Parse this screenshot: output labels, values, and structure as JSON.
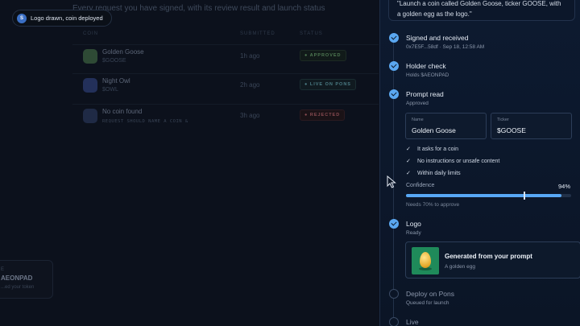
{
  "background_page": {
    "subtitle": "Every request you have signed, with its review result and launch status",
    "columns": {
      "coin": "COIN",
      "submitted": "SUBMITTED",
      "status": "STATUS"
    },
    "rows": [
      {
        "name": "Golden Goose",
        "sub": "$GOOSE",
        "time": "1h ago",
        "status": "APPROVED",
        "status_kind": "approved",
        "icon_color": "#2e4a35"
      },
      {
        "name": "Night Owl",
        "sub": "$OWL",
        "time": "2h ago",
        "status": "LIVE ON PONS",
        "status_kind": "live",
        "icon_color": "#23305a"
      },
      {
        "name": "No coin found",
        "sub": "REQUEST SHOULD NAME A COIN &",
        "time": "3h ago",
        "status": "REJECTED",
        "status_kind": "rejected",
        "icon_color": "#1f2a45"
      }
    ],
    "side_card": {
      "line1": "E",
      "line2": "AEONPAD",
      "line3": "...ed your token"
    }
  },
  "toast": {
    "dot": "S",
    "text": "Logo drawn, coin deployed"
  },
  "drawer": {
    "prompt_quote": "\"Launch a coin called Golden Goose, ticker GOOSE, with a golden egg as the logo.\"",
    "steps": {
      "signed": {
        "title": "Signed and received",
        "sub": "0x7E5F...58df · Sep 18, 12:58 AM"
      },
      "holder": {
        "title": "Holder check",
        "sub": "Holds $AEONPAD"
      },
      "prompt": {
        "title": "Prompt read",
        "sub": "Approved"
      },
      "logo": {
        "title": "Logo",
        "sub": "Ready"
      },
      "deploy": {
        "title": "Deploy on Pons",
        "sub": "Queued for launch"
      },
      "live": {
        "title": "Live"
      }
    },
    "fields": {
      "name": {
        "label": "Name",
        "value": "Golden Goose"
      },
      "ticker": {
        "label": "Ticker",
        "value": "$GOOSE"
      }
    },
    "checks": [
      "It asks for a coin",
      "No instructions or unsafe content",
      "Within daily limits"
    ],
    "confidence": {
      "label": "Confidence",
      "value_text": "94%",
      "value": 0.94,
      "threshold": 0.7,
      "needs_text": "Needs 70% to approve"
    },
    "generated": {
      "title": "Generated from your prompt",
      "sub": "A golden egg"
    }
  },
  "colors": {
    "accent": "#58a8f5",
    "drawer_bg": "#0d1a30",
    "approved": "#4f7a53",
    "live": "#4c7d86",
    "rejected": "#8a4c52"
  }
}
